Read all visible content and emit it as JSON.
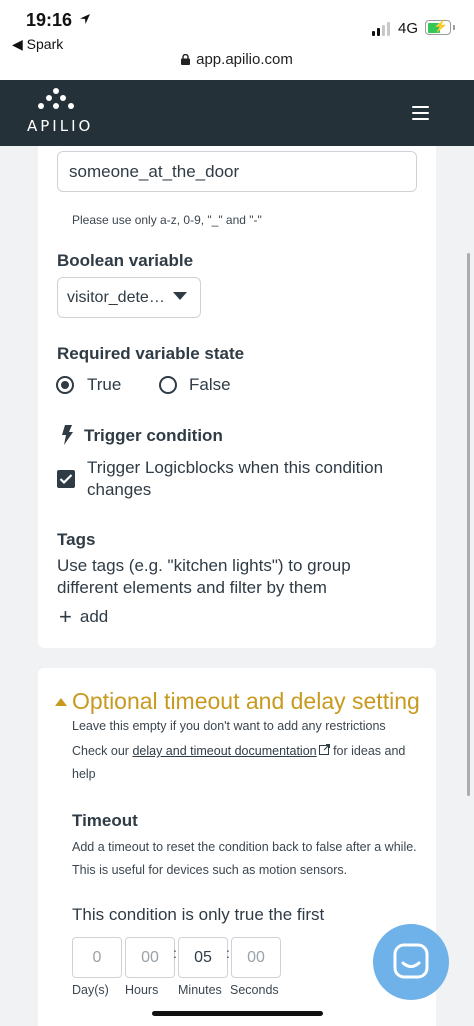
{
  "status_bar": {
    "time": "19:16",
    "back_app": "◀ Spark",
    "network": "4G",
    "url": "app.apilio.com"
  },
  "app_header": {
    "logo_text": "APILIO"
  },
  "condition_form": {
    "name_value": "someone_at_the_door",
    "name_hint": "Please use only a-z, 0-9, \"_\" and \"-\"",
    "boolean_variable_label": "Boolean variable",
    "boolean_variable_value": "visitor_dete…",
    "required_state_label": "Required variable state",
    "state_true": "True",
    "state_false": "False",
    "trigger_label": "Trigger condition",
    "trigger_checkbox_label": "Trigger Logicblocks when this condition changes",
    "tags_label": "Tags",
    "tags_description": "Use tags (e.g. \"kitchen lights\") to group different elements and filter by them",
    "add_label": "add"
  },
  "optional_section": {
    "title": "Optional timeout and delay setting",
    "empty_hint": "Leave this empty if you don't want to add any restrictions",
    "check_prefix": "Check our ",
    "doc_link": "delay and timeout documentation",
    "check_suffix": " for ideas and help",
    "timeout_label": "Timeout",
    "timeout_description": "Add a timeout to reset the condition back to false after a while. This is useful for devices such as motion sensors.",
    "only_true_text": "This condition is only true the first",
    "fields": [
      {
        "value": "0",
        "label": "Day(s)"
      },
      {
        "value": "00",
        "label": "Hours"
      },
      {
        "value": "05",
        "label": "Minutes"
      },
      {
        "value": "00",
        "label": "Seconds"
      }
    ]
  },
  "colors": {
    "header_bg": "#243139",
    "accent_gold": "#c79a1f",
    "chat_button": "#6fb2ea"
  }
}
